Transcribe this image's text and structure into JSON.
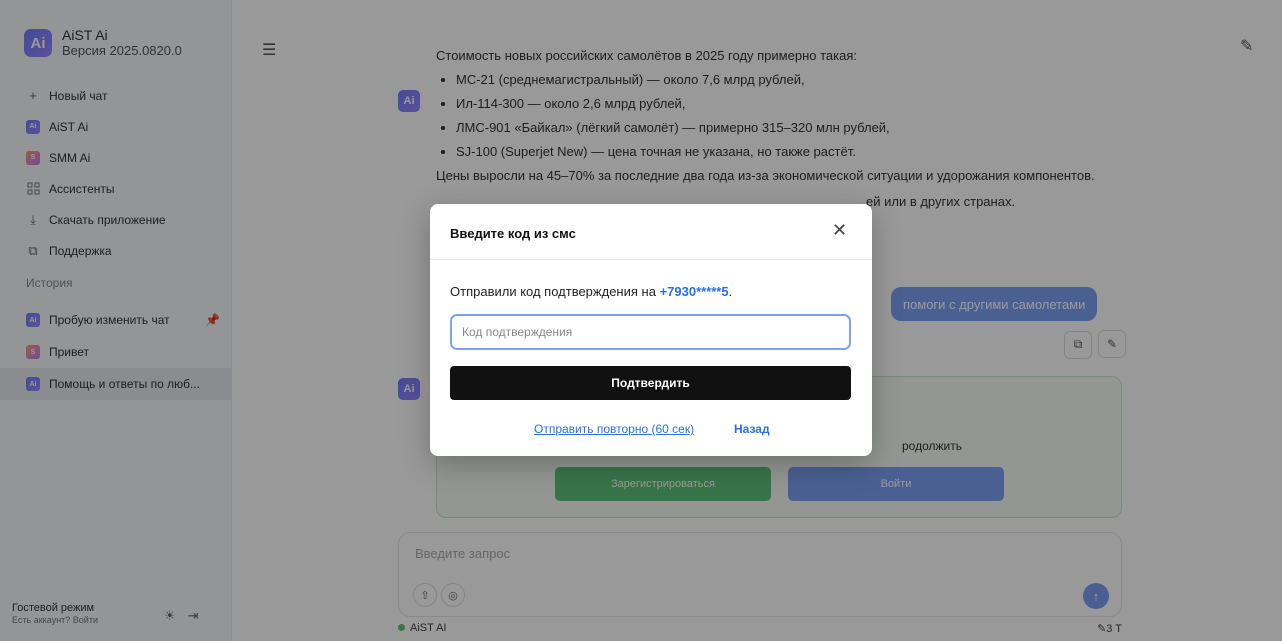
{
  "app": {
    "logo_text": "Ai",
    "name": "AiST Ai",
    "version": "Версия 2025.0820.0"
  },
  "nav": [
    {
      "label": "Новый чат",
      "icon": "plus-icon"
    },
    {
      "label": "AiST Ai",
      "icon": "aist-logo-icon"
    },
    {
      "label": "SMM Ai",
      "icon": "smm-logo-icon"
    },
    {
      "label": "Ассистенты",
      "icon": "grid-icon"
    },
    {
      "label": "Скачать приложение",
      "icon": "download-icon"
    },
    {
      "label": "Поддержка",
      "icon": "external-link-icon"
    }
  ],
  "history": {
    "label": "История",
    "items": [
      {
        "label": "Пробую изменить чат",
        "pinned": true
      },
      {
        "label": "Привет"
      },
      {
        "label": "Помощь и ответы по люб..."
      }
    ]
  },
  "footer": {
    "guest_mode": "Гостевой режим",
    "account_prompt": "Есть аккаунт? Войти"
  },
  "chat": {
    "intro": "Стоимость новых российских самолётов в 2025 году примерно такая:",
    "bullets": [
      "МС-21 (среднемагистральный) — около 7,6 млрд рублей,",
      "Ил-114-300 — около 2,6 млрд рублей,",
      "ЛМС-901 «Байкал» (лёгкий самолёт) — примерно 315–320 млн рублей,",
      "SJ-100 (Superjet New) — цена точная не указана, но также растёт."
    ],
    "paragraph": "Цены выросли на 45–70% за последние два года из-за экономической ситуации и удорожания компонентов.",
    "partial_text": "ей или в других странах.",
    "user_message": "помоги с другими самолетами",
    "register_text": "родолжить",
    "register_button": "Зарегистрироваться",
    "login_button": "Войти",
    "input_placeholder": "Введите запрос",
    "model": "AiST AI",
    "tokens": "3 T"
  },
  "modal": {
    "title": "Введите код из смс",
    "text": "Отправили код подтверждения на",
    "phone": "+7930*****5",
    "placeholder": "Код подтверждения",
    "confirm": "Подтвердить",
    "resend": "Отправить повторно (60 сек)",
    "back": "Назад"
  }
}
